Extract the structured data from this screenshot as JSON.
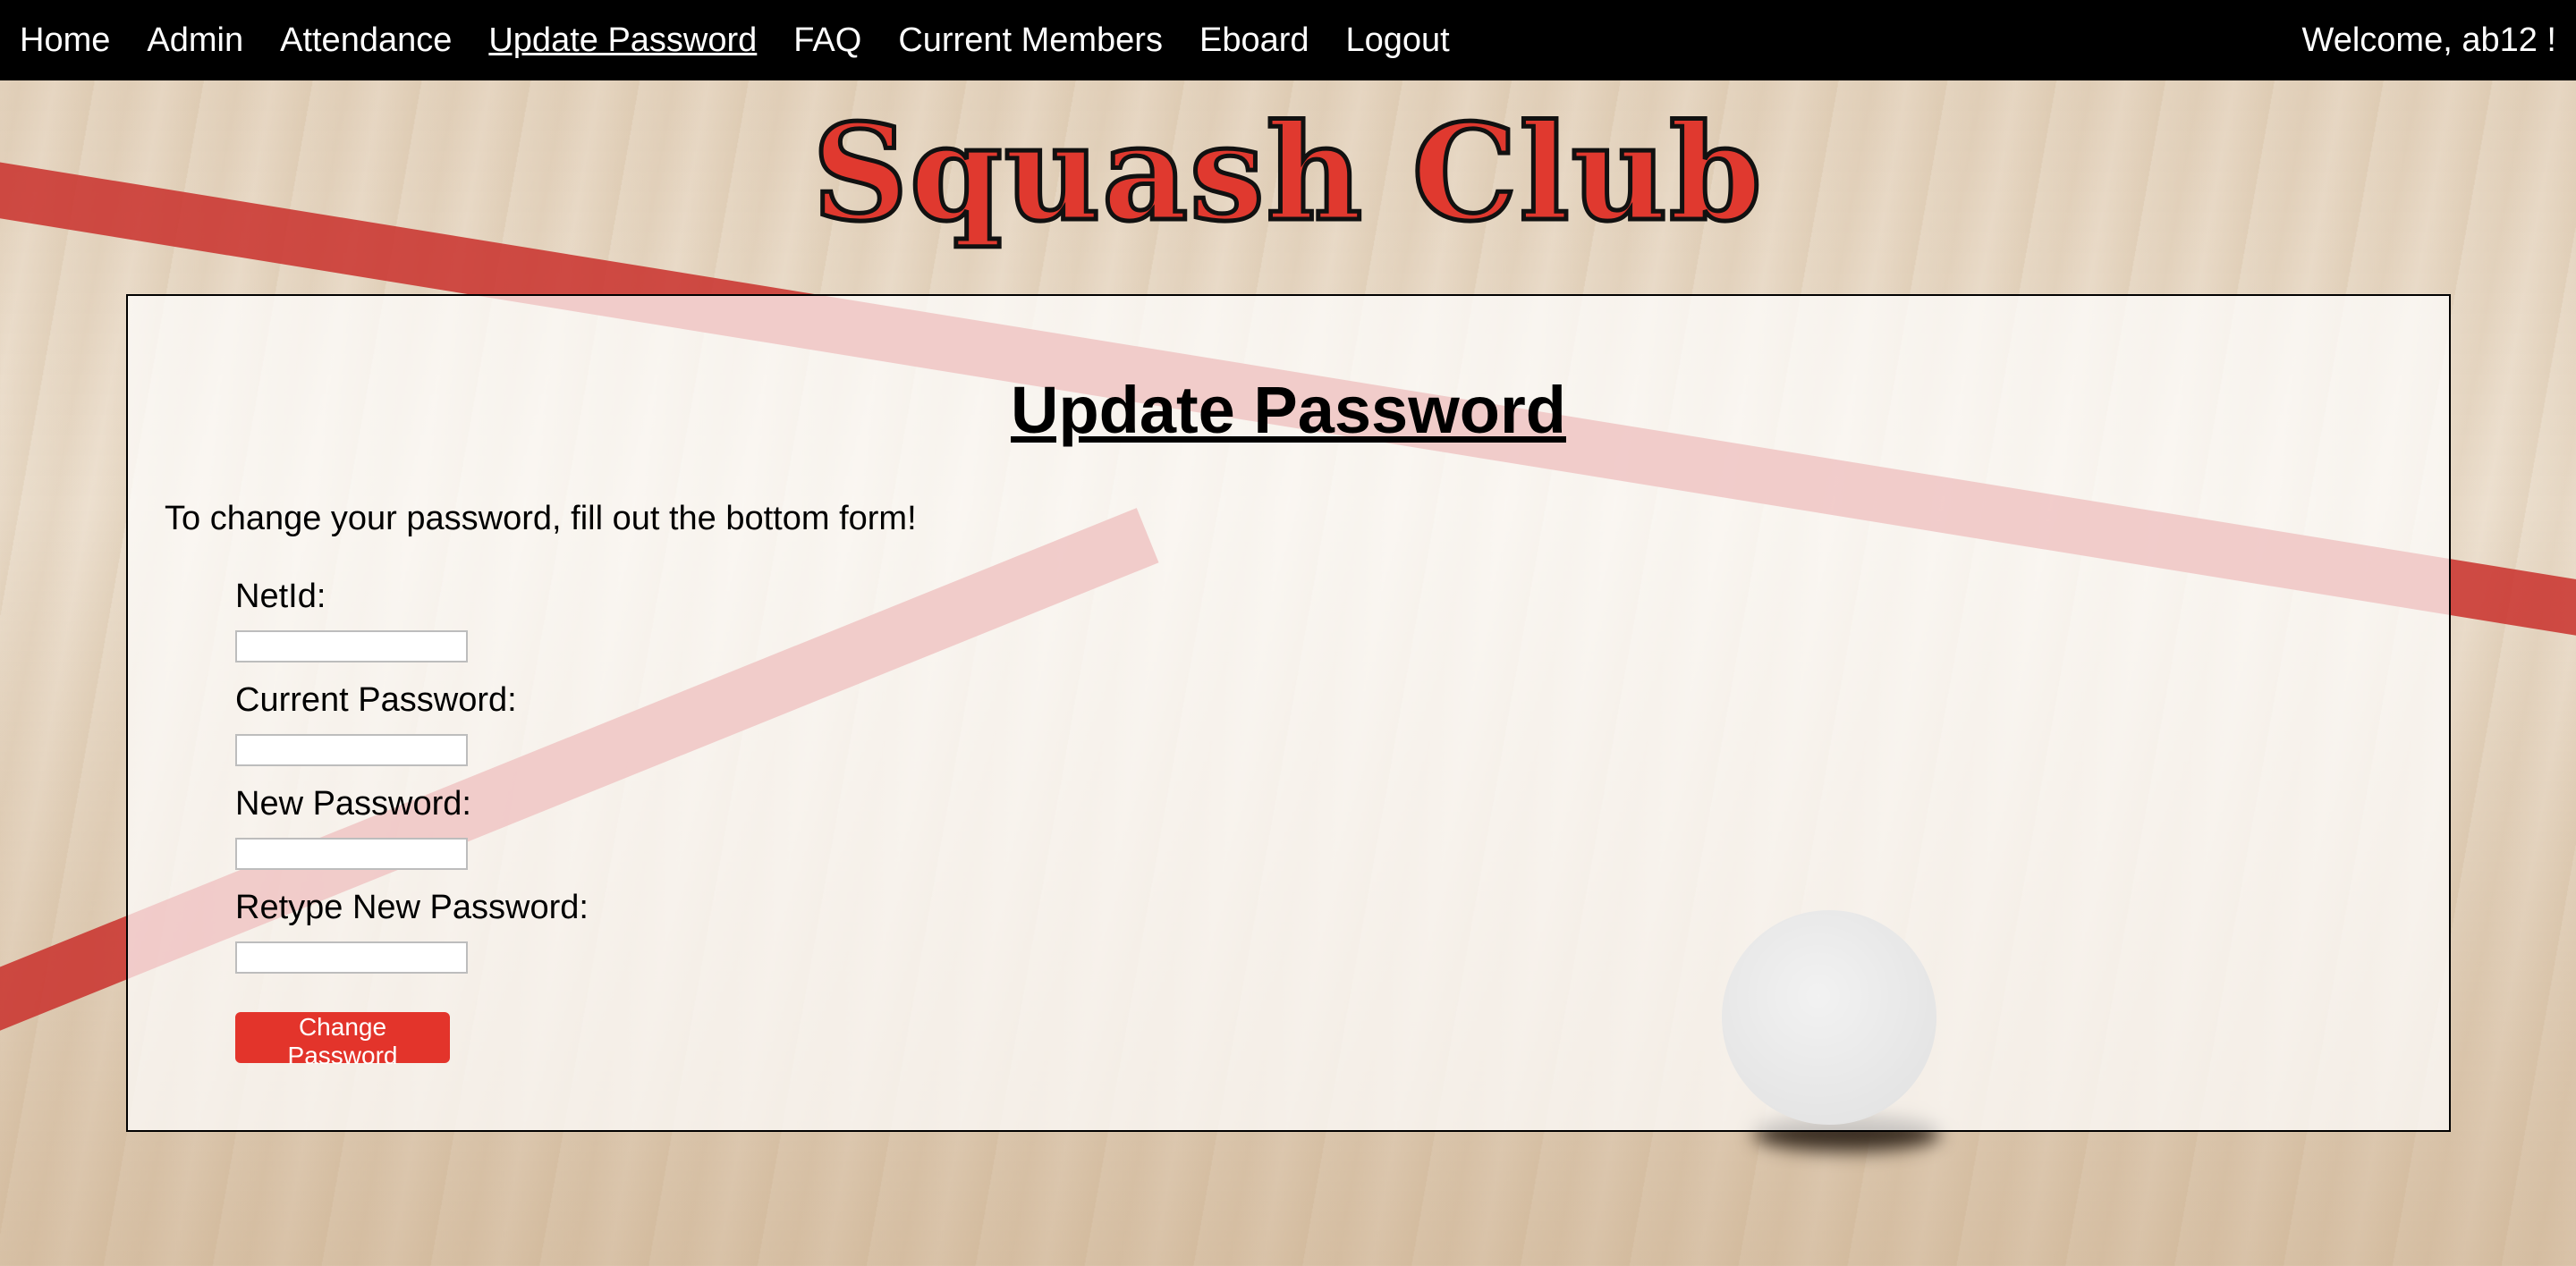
{
  "nav": {
    "links": [
      {
        "label": "Home"
      },
      {
        "label": "Admin"
      },
      {
        "label": "Attendance"
      },
      {
        "label": "Update Password",
        "active": true
      },
      {
        "label": "FAQ"
      },
      {
        "label": "Current Members"
      },
      {
        "label": "Eboard"
      },
      {
        "label": "Logout"
      }
    ],
    "welcome": "Welcome, ab12 !"
  },
  "site_title": "Squash Club",
  "page": {
    "heading": "Update Password",
    "intro": "To change your password, fill out the bottom form!",
    "form": {
      "fields": [
        {
          "label": "NetId:",
          "value": "",
          "placeholder": ""
        },
        {
          "label": "Current Password:",
          "value": "",
          "placeholder": ""
        },
        {
          "label": "New Password:",
          "value": "",
          "placeholder": ""
        },
        {
          "label": "Retype New Password:",
          "value": "",
          "placeholder": ""
        }
      ],
      "submit_label": "Change Password"
    }
  },
  "colors": {
    "nav_background": "#000000",
    "title_red": "#e0392f",
    "button_red": "#e3342b",
    "court_line_red": "#c9302c"
  }
}
